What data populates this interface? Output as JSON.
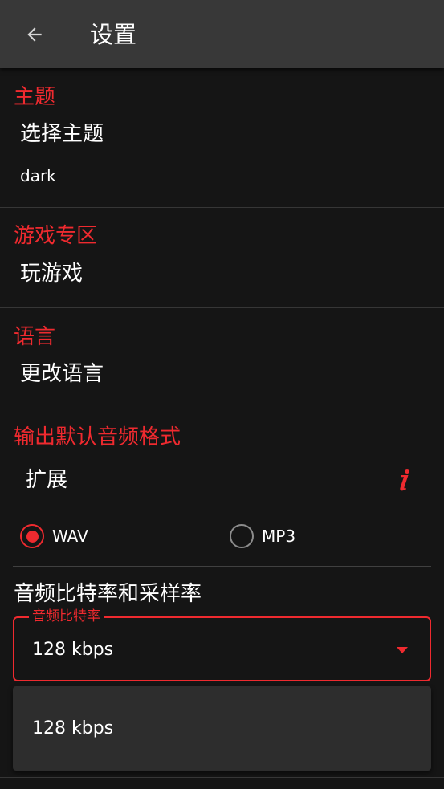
{
  "app_bar": {
    "title": "设置",
    "back_icon": "arrow-left-icon"
  },
  "theme": {
    "header": "主题",
    "title": "选择主题",
    "summary": "dark"
  },
  "games": {
    "header": "游戏专区",
    "title": "玩游戏"
  },
  "language": {
    "header": "语言",
    "title": "更改语言"
  },
  "audio_format": {
    "header": "输出默认音频格式",
    "extension_label": "扩展",
    "info_icon": "info-icon",
    "options": [
      {
        "label": "WAV",
        "selected": true
      },
      {
        "label": "MP3",
        "selected": false
      }
    ]
  },
  "bitrate": {
    "section_title": "音频比特率和采样率",
    "field_label": "音频比特率",
    "value": "128 kbps",
    "dropdown_icon": "triangle-down-icon",
    "menu_options": [
      "128 kbps"
    ]
  },
  "colors": {
    "accent": "#ef2a2f",
    "background": "#151515",
    "app_bar": "#383838",
    "text": "#ffffff",
    "radio_unchecked": "#8c8c8c",
    "menu": "#2d2d2d",
    "divider": "#363636"
  }
}
